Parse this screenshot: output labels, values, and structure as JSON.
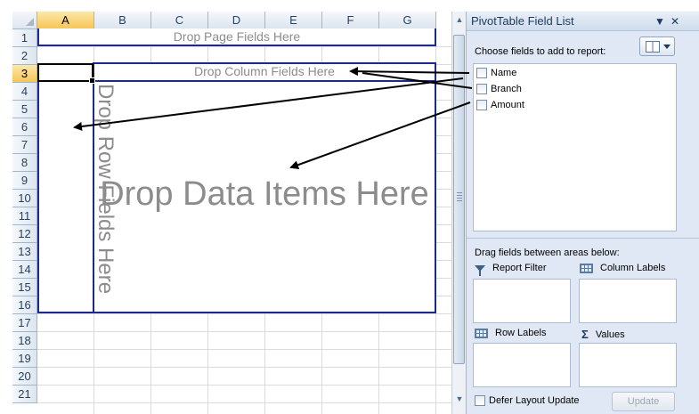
{
  "sheet": {
    "columns": [
      "A",
      "B",
      "C",
      "D",
      "E",
      "F",
      "G"
    ],
    "active_column": "A",
    "rows": [
      "1",
      "2",
      "3",
      "4",
      "5",
      "6",
      "7",
      "8",
      "9",
      "10",
      "11",
      "12",
      "13",
      "14",
      "15",
      "16",
      "17",
      "18",
      "19",
      "20",
      "21"
    ],
    "active_row": "3",
    "drop_page": "Drop Page Fields Here",
    "drop_column": "Drop Column Fields Here",
    "drop_row": "Drop Row Fields Here",
    "drop_data": "Drop Data Items Here"
  },
  "panel": {
    "title": "PivotTable Field List",
    "dropdown_glyph": "▼",
    "close_glyph": "✕",
    "choose_label": "Choose fields to add to report:",
    "fields": [
      {
        "label": "Name",
        "checked": false
      },
      {
        "label": "Branch",
        "checked": false
      },
      {
        "label": "Amount",
        "checked": false
      }
    ],
    "drag_label": "Drag fields between areas below:",
    "areas": {
      "report_filter": "Report Filter",
      "column_labels": "Column Labels",
      "row_labels": "Row Labels",
      "values": "Values"
    },
    "defer_label": "Defer Layout Update",
    "update_label": "Update"
  },
  "colors": {
    "drop_border": "#1b2a8c",
    "drop_text": "#8c8c8c",
    "active_header": "#f6c65a",
    "panel_bg": "#dfe8f4"
  }
}
